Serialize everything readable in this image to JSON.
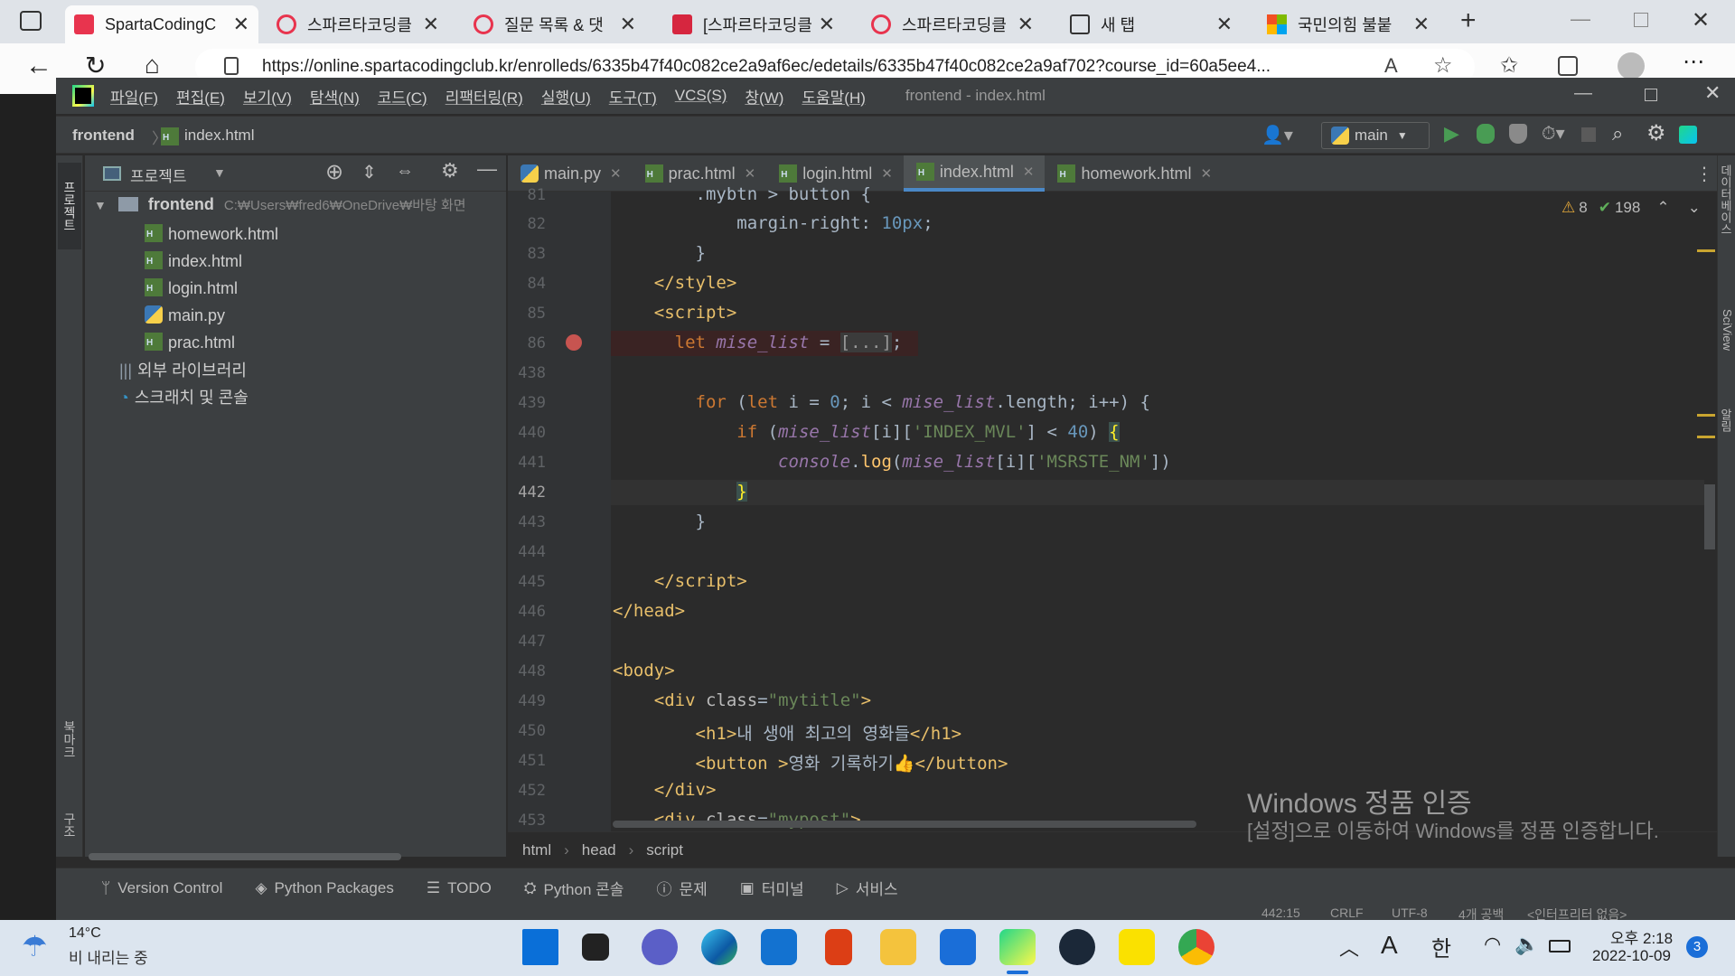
{
  "browser": {
    "tabs": [
      {
        "title": "SpartaCodingC",
        "active": true
      },
      {
        "title": "스파르타코딩클",
        "active": false
      },
      {
        "title": "질문 목록 & 댓",
        "active": false
      },
      {
        "title": "[스파르타코딩클",
        "active": false
      },
      {
        "title": "스파르타코딩클",
        "active": false
      },
      {
        "title": "새 탭",
        "active": false
      },
      {
        "title": "국민의힘 불붙",
        "active": false
      }
    ],
    "url": "https://online.spartacodingclub.kr/enrolleds/6335b47f40c082ce2a9af6ec/edetails/6335b47f40c082ce2a9af702?course_id=60a5ee4..."
  },
  "ide": {
    "title": "frontend - index.html",
    "menu": [
      "파일(F)",
      "편집(E)",
      "보기(V)",
      "탐색(N)",
      "코드(C)",
      "리팩터링(R)",
      "실행(U)",
      "도구(T)",
      "VCS(S)",
      "창(W)",
      "도움말(H)"
    ],
    "nav": {
      "project": "frontend",
      "file": "index.html"
    },
    "run_config": "main",
    "left_strip": {
      "project": "프로젝트",
      "bookmarks": "북마크",
      "structure": "구조"
    },
    "right_strip": {
      "database": "데이터베이스",
      "sciview": "SciView",
      "notifications": "알림"
    },
    "project_panel": {
      "title": "프로젝트",
      "root": "frontend",
      "root_path": "C:₩Users₩fred6₩OneDrive₩바탕 화면",
      "files": [
        "homework.html",
        "index.html",
        "login.html",
        "main.py",
        "prac.html"
      ],
      "external": "외부 라이브러리",
      "scratches": "스크래치 및 콘솔"
    },
    "editor_tabs": [
      "main.py",
      "prac.html",
      "login.html",
      "index.html",
      "homework.html"
    ],
    "inspections": {
      "warnings": "8",
      "ok": "198"
    },
    "line_numbers": [
      "81",
      "82",
      "83",
      "84",
      "85",
      "86",
      "438",
      "439",
      "440",
      "441",
      "442",
      "443",
      "444",
      "445",
      "446",
      "447",
      "448",
      "449",
      "450",
      "451",
      "452",
      "453"
    ],
    "breadcrumbs": [
      "html",
      "head",
      "script"
    ],
    "bottom_tools": [
      "Version Control",
      "Python Packages",
      "TODO",
      "Python 콘솔",
      "문제",
      "터미널",
      "서비스"
    ],
    "status": {
      "position": "442:15",
      "line_sep": "CRLF",
      "encoding": "UTF-8",
      "indent": "4개 공백",
      "interpreter": "<인터프리터 없음>"
    }
  },
  "watermark": {
    "title": "Windows 정품 인증",
    "text": "[설정]으로 이동하여 Windows를 정품 인증합니다."
  },
  "taskbar": {
    "weather_temp": "14°C",
    "weather_desc": "비 내리는 중",
    "time": "오후 2:18",
    "date": "2022-10-09",
    "notif_count": "3",
    "ime_a": "A",
    "ime_lang": "한"
  },
  "colors": {
    "accent": "#4a88c7",
    "editor_bg": "#2b2b2b",
    "panel_bg": "#3c3f41",
    "breakpoint": "#c75450"
  }
}
